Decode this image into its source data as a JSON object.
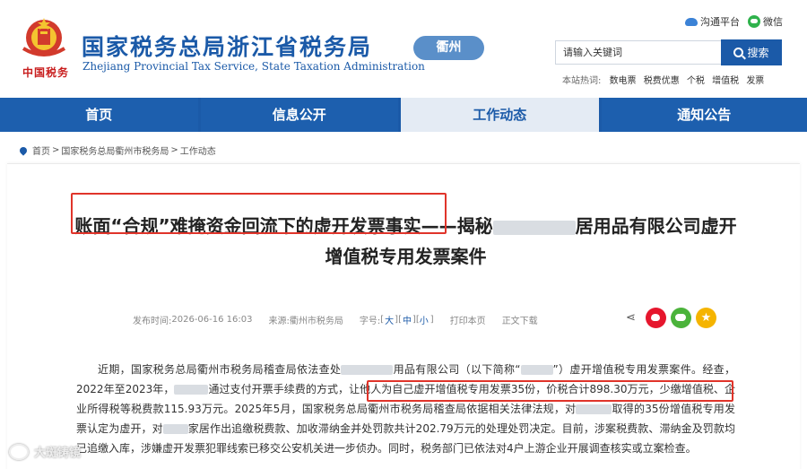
{
  "header": {
    "seal_text": "中国税务",
    "site_title": "国家税务总局浙江省税务局",
    "site_subtitle": "Zhejiang Provincial Tax Service, State Taxation Administration",
    "city_badge": "衢州",
    "platform_link": "沟通平台",
    "wechat_link": "微信"
  },
  "search": {
    "placeholder": "请输入关键词",
    "button_label": "搜索"
  },
  "hotwords": {
    "label": "本站热词:",
    "items": [
      "数电票",
      "税费优惠",
      "个税",
      "增值税",
      "发票"
    ]
  },
  "nav": {
    "items": [
      "首页",
      "信息公开",
      "工作动态",
      "通知公告"
    ],
    "active_index": 2
  },
  "breadcrumb": [
    "首页",
    "国家税务总局衢州市税务局",
    "工作动态"
  ],
  "article": {
    "title": "账面“合规”难掩资金回流下的虚开发票事实——揭秘",
    "title_tail": "居用品有限公司虚开增值税专用发票案件",
    "publish_label": "发布时间:",
    "publish_time": "2026-06-16 16:03",
    "source_label": "来源:",
    "source": "衢州市税务局",
    "font_label": "字号:",
    "font_sizes": [
      "大",
      "中",
      "小"
    ],
    "print_label": "打印本页",
    "download_label": "正文下载",
    "body": {
      "p1": "近期，国家税务总局衢州市税务局稽查局依法查处",
      "p2": "用品有限公司（以下简称“",
      "p3": "”）虚开增值税专用发票案件。经查，2022年至2023年，",
      "p4": "通过支付开票手续费的方式，",
      "p5_highlight": "让他人为自己虚开增值税专用发票35份，价税合计898.30万元，少缴增值",
      "p6": "税、企业所得税等税费款115.93万元。2025年5月，国家税务总局衢州市税务局稽查局依据相关法律法规，对",
      "p7": "取得的35份增值税专用发票认定为虚开，对",
      "p8": "家居作出追缴税费款、加收滞纳金并处罚款共计202.79万元的处理处罚决定。目前，涉案税费款、滞纳金及罚款均已追缴入库，涉嫌虚开发票犯罪线索已移交公安机关进一步侦办。同时，税务部门已依法对4户上游企业开展调查核实或立案检查。"
    }
  },
  "watermark": "大斑铸镜",
  "colors": {
    "brand_blue": "#1b5aa8",
    "highlight_red": "#e0342a"
  }
}
